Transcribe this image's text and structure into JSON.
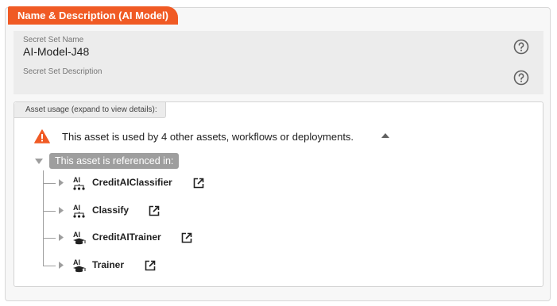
{
  "section_tab": "Name & Description (AI Model)",
  "fields": {
    "name_label": "Secret Set Name",
    "name_value": "AI-Model-J48",
    "desc_label": "Secret Set Description",
    "desc_value": ""
  },
  "usage": {
    "title": "Asset usage (expand to view details):",
    "warning": "This asset is used by 4 other assets, workflows or deployments.",
    "referenced_label": "This asset is referenced in:",
    "items": [
      {
        "label": "CreditAIClassifier",
        "icon": "ai-classifier-icon"
      },
      {
        "label": "Classify",
        "icon": "ai-classifier-icon"
      },
      {
        "label": "CreditAITrainer",
        "icon": "ai-trainer-icon"
      },
      {
        "label": "Trainer",
        "icon": "ai-trainer-icon"
      }
    ]
  },
  "colors": {
    "accent": "#f05a24",
    "warning": "#f05a24",
    "badge": "#9e9e9e"
  },
  "icons": [
    "help-icon",
    "warning-icon",
    "collapse-up-icon",
    "expand-right-icon",
    "external-link-icon"
  ]
}
